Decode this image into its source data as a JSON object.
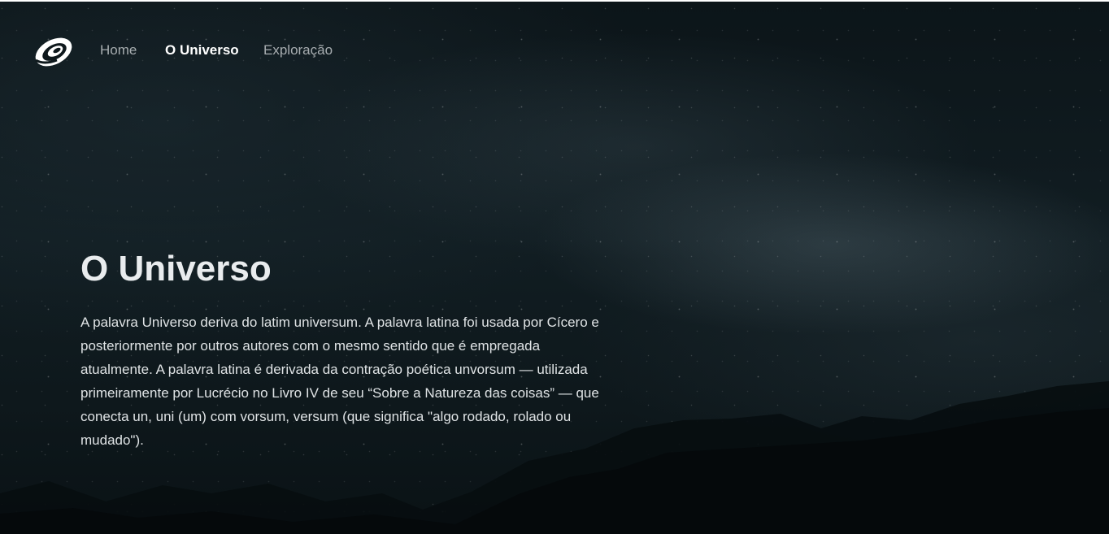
{
  "brand": {
    "logo_icon": "swirl-logo-icon"
  },
  "nav": {
    "items": [
      {
        "label": "Home",
        "active": false
      },
      {
        "label": "O Universo",
        "active": true
      },
      {
        "label": "Exploração",
        "active": false
      }
    ]
  },
  "main": {
    "title": "O Universo",
    "paragraph": "A palavra Universo deriva do latim universum. A palavra latina foi usada por Cícero e posteriormente por outros autores com o mesmo sentido que é empregada atualmente. A palavra latina é derivada da contração poética unvorsum — utilizada primeiramente por Lucrécio no Livro IV de seu “Sobre a Natureza das coisas” — que conecta un, uni (um) com vorsum, versum (que significa \"algo rodado, rolado ou mudado\")."
  },
  "colors": {
    "background": "#0b1418",
    "nav_inactive": "#a7adb0",
    "nav_active": "#ffffff",
    "text": "#dfe3e5"
  }
}
